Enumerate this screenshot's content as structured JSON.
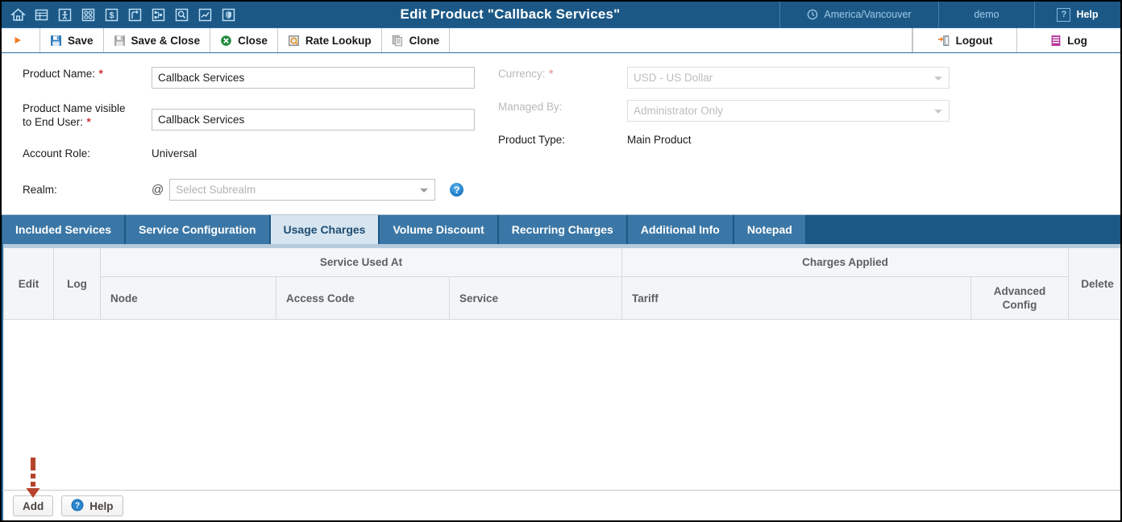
{
  "header": {
    "title": "Edit Product \"Callback Services\"",
    "timezone": "America/Vancouver",
    "user": "demo",
    "help_label": "Help",
    "nav_icons": [
      "home-icon",
      "table-icon",
      "person-icon",
      "circles-grid-icon",
      "dollar-icon",
      "branch-arrow-icon",
      "sitemap-icon",
      "magnifier-icon",
      "line-chart-icon",
      "shield-icon"
    ]
  },
  "toolbar": {
    "run_label": "",
    "save_label": "Save",
    "save_close_label": "Save & Close",
    "close_label": "Close",
    "rate_lookup_label": "Rate Lookup",
    "clone_label": "Clone",
    "logout_label": "Logout",
    "log_label": "Log"
  },
  "form": {
    "product_name_label": "Product Name:",
    "product_name_value": "Callback Services",
    "product_name_visible_label": "Product Name visible",
    "product_name_visible_label2": "to End User:",
    "product_name_visible_value": "Callback Services",
    "account_role_label": "Account Role:",
    "account_role_value": "Universal",
    "realm_label": "Realm:",
    "realm_at": "@",
    "realm_placeholder": "Select Subrealm",
    "currency_label": "Currency:",
    "currency_value": "USD - US Dollar",
    "managed_by_label": "Managed By:",
    "managed_by_value": "Administrator Only",
    "product_type_label": "Product Type:",
    "product_type_value": "Main Product",
    "required_marker": "*",
    "help_icon_glyph": "?"
  },
  "tabs": [
    {
      "label": "Included Services",
      "active": false
    },
    {
      "label": "Service Configuration",
      "active": false
    },
    {
      "label": "Usage Charges",
      "active": true
    },
    {
      "label": "Volume Discount",
      "active": false
    },
    {
      "label": "Recurring Charges",
      "active": false
    },
    {
      "label": "Additional Info",
      "active": false
    },
    {
      "label": "Notepad",
      "active": false
    }
  ],
  "grid": {
    "col_edit": "Edit",
    "col_log": "Log",
    "group_service_used_at": "Service Used At",
    "group_charges_applied": "Charges Applied",
    "col_node": "Node",
    "col_access_code": "Access Code",
    "col_service": "Service",
    "col_tariff": "Tariff",
    "col_advanced_config_line1": "Advanced",
    "col_advanced_config_line2": "Config",
    "col_delete": "Delete",
    "rows": []
  },
  "footer": {
    "add_label": "Add",
    "help_label": "Help"
  },
  "annotation": {
    "arrow_color": "#b5432a",
    "points_to": "add-button"
  },
  "colors": {
    "header_blue": "#1b5886",
    "tab_blue": "#3b77a6",
    "active_tab_bg": "#d7e5f0",
    "required_red": "#cc3333",
    "annotation_red": "#b5432a"
  }
}
